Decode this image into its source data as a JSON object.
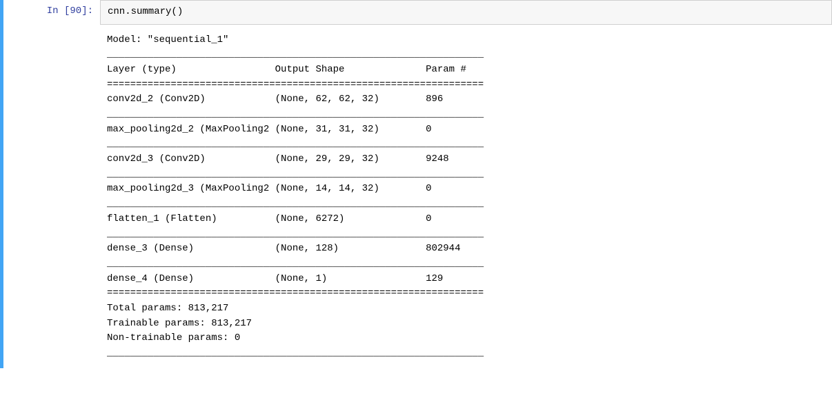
{
  "prompt": {
    "in_label": "In [",
    "exec_count": "90",
    "close": "]:"
  },
  "code": {
    "line": "cnn.summary()"
  },
  "summary": {
    "col_widths": {
      "layer": 29,
      "output": 26,
      "param": 0
    },
    "rule_len": 65,
    "model_line": "Model: \"sequential_1\"",
    "header": {
      "layer": "Layer (type)",
      "output": "Output Shape",
      "param": "Param #"
    },
    "rows": [
      {
        "layer": "conv2d_2 (Conv2D)",
        "output": "(None, 62, 62, 32)",
        "param": "896"
      },
      {
        "layer": "max_pooling2d_2 (MaxPooling2",
        "output": "(None, 31, 31, 32)",
        "param": "0"
      },
      {
        "layer": "conv2d_3 (Conv2D)",
        "output": "(None, 29, 29, 32)",
        "param": "9248"
      },
      {
        "layer": "max_pooling2d_3 (MaxPooling2",
        "output": "(None, 14, 14, 32)",
        "param": "0"
      },
      {
        "layer": "flatten_1 (Flatten)",
        "output": "(None, 6272)",
        "param": "0"
      },
      {
        "layer": "dense_3 (Dense)",
        "output": "(None, 128)",
        "param": "802944"
      },
      {
        "layer": "dense_4 (Dense)",
        "output": "(None, 1)",
        "param": "129"
      }
    ],
    "totals": {
      "total": "Total params: 813,217",
      "trainable": "Trainable params: 813,217",
      "nontrainable": "Non-trainable params: 0"
    }
  }
}
